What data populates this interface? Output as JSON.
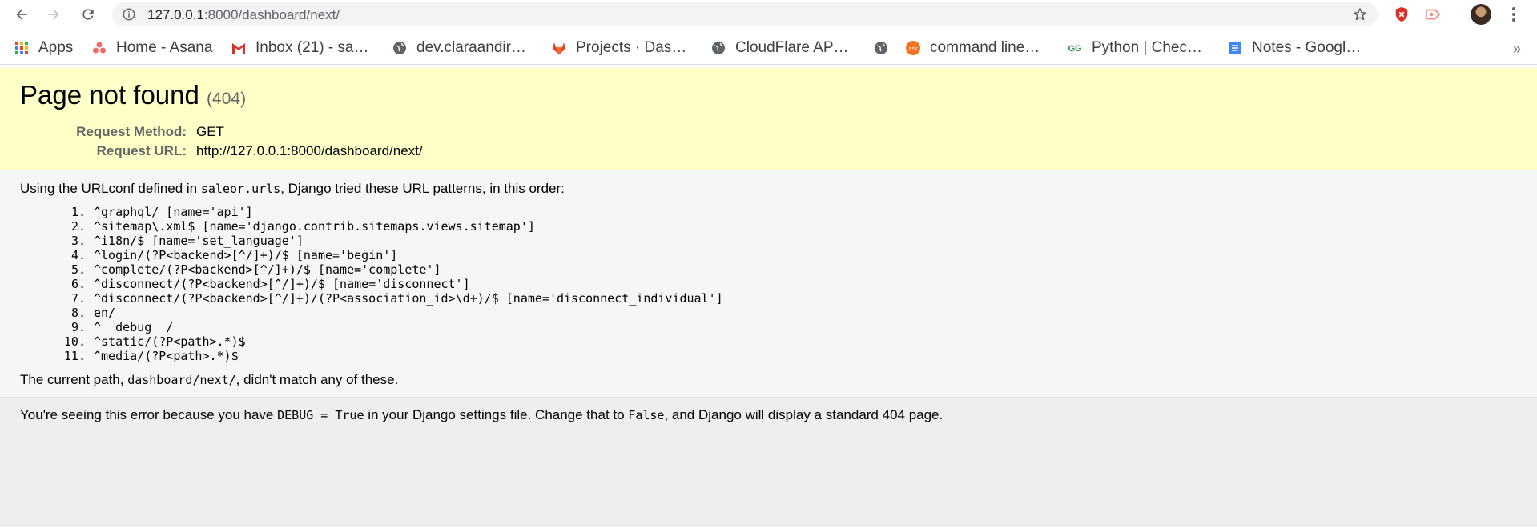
{
  "browser": {
    "url_host": "127.0.0.1",
    "url_rest": ":8000/dashboard/next/",
    "bookmarks": [
      {
        "label": "Apps",
        "icon": "apps-grid-icon"
      },
      {
        "label": "Home - Asana",
        "icon": "asana-icon"
      },
      {
        "label": "Inbox (21) - sa…",
        "icon": "gmail-icon"
      },
      {
        "label": "dev.claraandir…",
        "icon": "globe-icon"
      },
      {
        "label": "Projects · Das…",
        "icon": "gitlab-icon"
      },
      {
        "label": "CloudFlare AP…",
        "icon": "globe-icon"
      },
      {
        "label": "",
        "icon": "globe-icon"
      },
      {
        "label": "command line…",
        "icon": "askubuntu-icon"
      },
      {
        "label": "Python | Chec…",
        "icon": "geeksforgeeks-icon"
      },
      {
        "label": "Notes - Googl…",
        "icon": "google-docs-icon"
      }
    ],
    "more_label": "»"
  },
  "summary": {
    "title": "Page not found",
    "status": "(404)",
    "method_label": "Request Method:",
    "method_value": "GET",
    "url_label": "Request URL:",
    "url_value": "http://127.0.0.1:8000/dashboard/next/"
  },
  "info": {
    "intro_pre": "Using the URLconf defined in ",
    "intro_code": "saleor.urls",
    "intro_post": ", Django tried these URL patterns, in this order:",
    "patterns": [
      "^graphql/ [name='api']",
      "^sitemap\\.xml$ [name='django.contrib.sitemaps.views.sitemap']",
      "^i18n/$ [name='set_language']",
      "^login/(?P<backend>[^/]+)/$ [name='begin']",
      "^complete/(?P<backend>[^/]+)/$ [name='complete']",
      "^disconnect/(?P<backend>[^/]+)/$ [name='disconnect']",
      "^disconnect/(?P<backend>[^/]+)/(?P<association_id>\\d+)/$ [name='disconnect_individual']",
      "en/",
      "^__debug__/",
      "^static/(?P<path>.*)$",
      "^media/(?P<path>.*)$"
    ],
    "current_pre": "The current path, ",
    "current_code": "dashboard/next/",
    "current_post": ", didn't match any of these."
  },
  "explanation": {
    "pre": "You're seeing this error because you have ",
    "code1": "DEBUG = True",
    "mid": " in your Django settings file. Change that to ",
    "code2": "False",
    "post": ", and Django will display a standard 404 page."
  }
}
